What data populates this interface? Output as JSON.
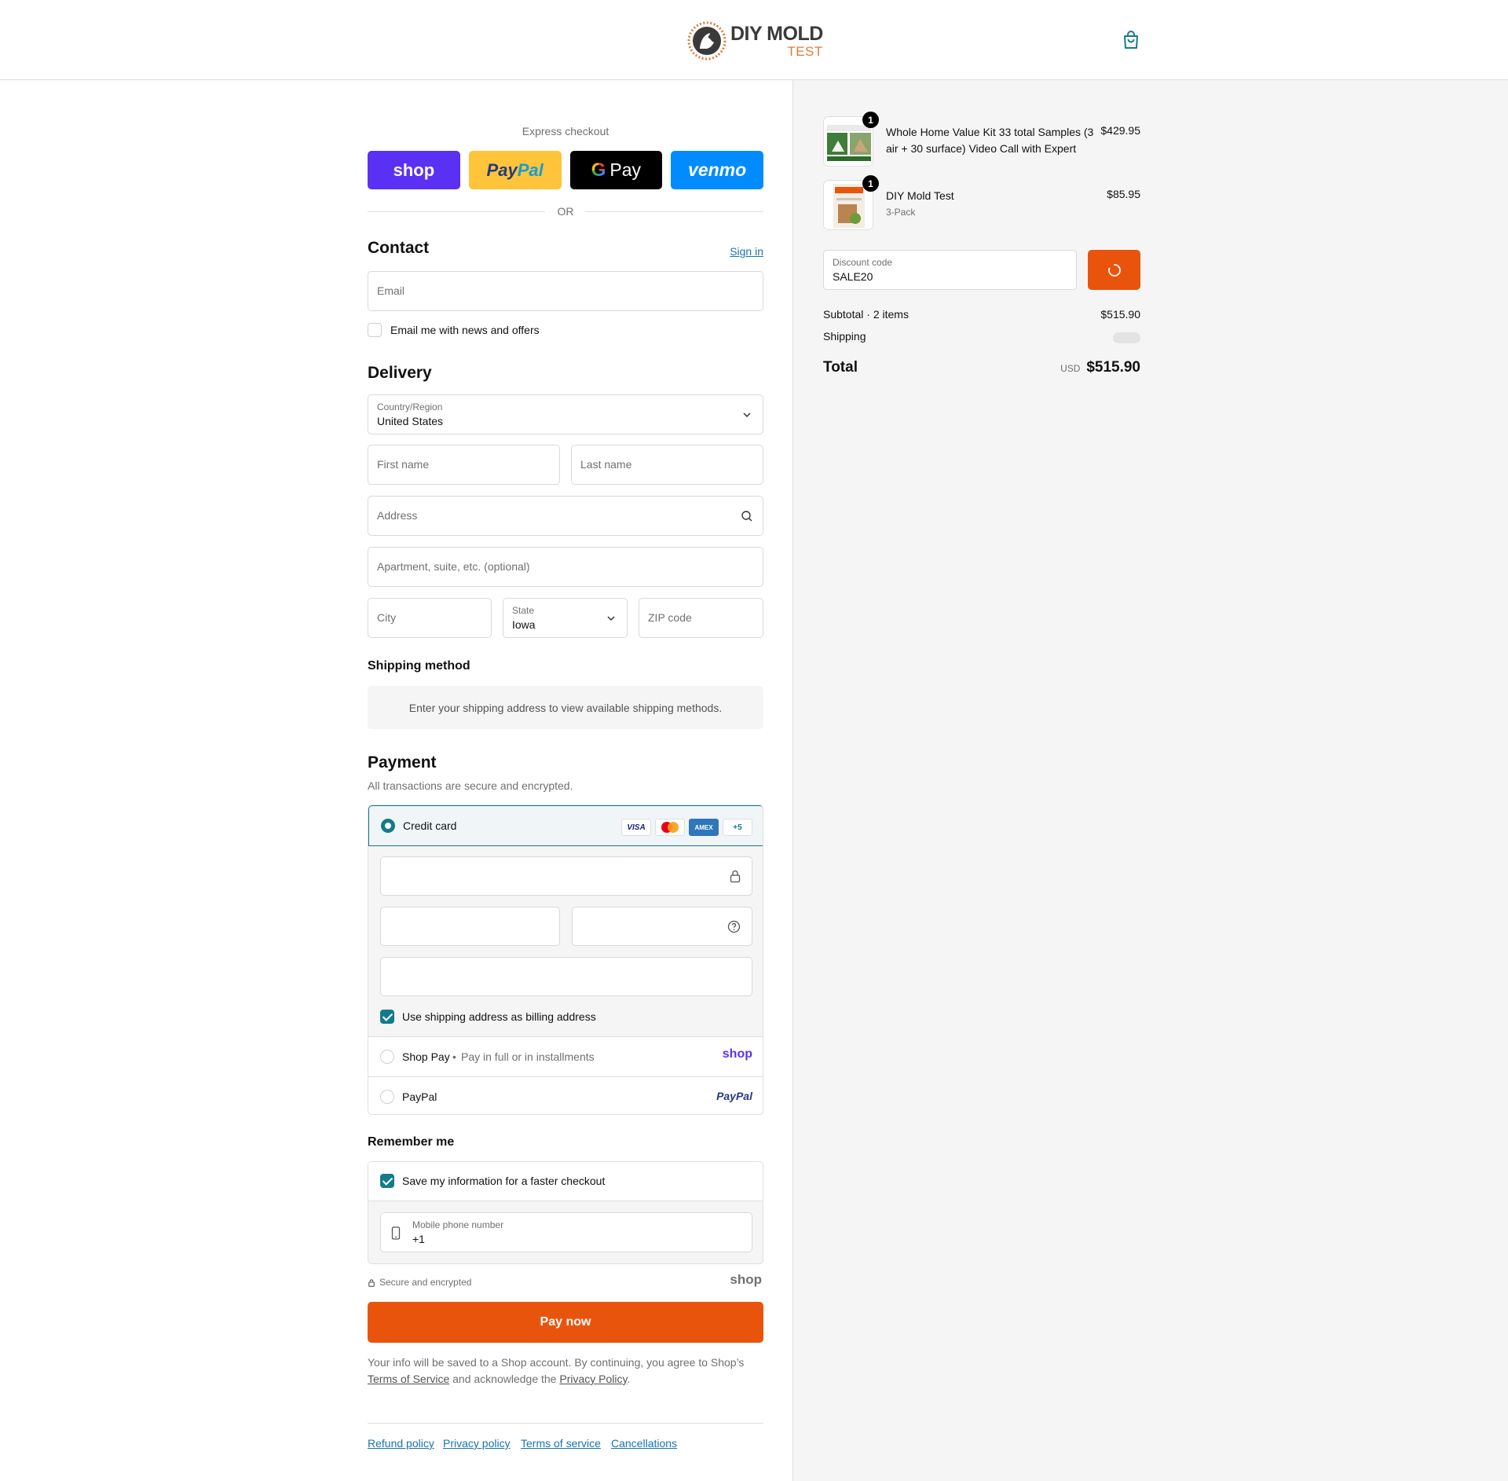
{
  "header": {
    "logo_main": "DIY MOLD",
    "logo_sub": "TEST",
    "cart_icon": "shopping-bag-icon"
  },
  "express": {
    "label": "Express checkout",
    "shop": "shop",
    "paypal": "PayPal",
    "gpay": "Pay",
    "venmo": "venmo",
    "or": "OR"
  },
  "contact": {
    "title": "Contact",
    "sign_in": "Sign in",
    "email_placeholder": "Email",
    "news_label": "Email me with news and offers",
    "news_checked": false
  },
  "delivery": {
    "title": "Delivery",
    "country_label": "Country/Region",
    "country_value": "United States",
    "first_name_placeholder": "First name",
    "last_name_placeholder": "Last name",
    "address_placeholder": "Address",
    "apartment_placeholder": "Apartment, suite, etc. (optional)",
    "city_placeholder": "City",
    "state_label": "State",
    "state_value": "Iowa",
    "zip_placeholder": "ZIP code"
  },
  "shipping_method": {
    "title": "Shipping method",
    "message": "Enter your shipping address to view available shipping methods."
  },
  "payment": {
    "title": "Payment",
    "subtitle": "All transactions are secure and encrypted.",
    "credit_card_label": "Credit card",
    "card_brands": [
      "VISA",
      "",
      "AMEX",
      "+5"
    ],
    "billing_same_label": "Use shipping address as billing address",
    "billing_same_checked": true,
    "shop_pay_label": "Shop Pay",
    "shop_pay_sub": "Pay in full or in installments",
    "shop_pay_logo": "shop",
    "paypal_label": "PayPal",
    "paypal_logo": "PayPal"
  },
  "remember": {
    "title": "Remember me",
    "save_label": "Save my information for a faster checkout",
    "save_checked": true,
    "phone_label": "Mobile phone number",
    "phone_value": "+1",
    "secure_label": "Secure and encrypted",
    "shop_logo": "shop"
  },
  "pay_now": "Pay now",
  "legal": {
    "text1": "Your info will be saved to a Shop account. By continuing, you agree to Shop’s",
    "terms": "Terms of Service",
    "text2": "and acknowledge the",
    "privacy": "Privacy Policy",
    "text3": "."
  },
  "footer": {
    "links": [
      "Refund policy",
      "Privacy policy",
      "Terms of service",
      "Cancellations"
    ]
  },
  "summary": {
    "items": [
      {
        "qty": "1",
        "name": "Whole Home Value Kit 33 total Samples (3 air + 30 surface) Video Call with Expert",
        "variant": "",
        "price": "$429.95"
      },
      {
        "qty": "1",
        "name": "DIY Mold Test",
        "variant": "3-Pack",
        "price": "$85.95"
      }
    ],
    "discount_label": "Discount code",
    "discount_value": "SALE20",
    "subtotal_label": "Subtotal · 2 items",
    "subtotal_value": "$515.90",
    "shipping_label": "Shipping",
    "total_label": "Total",
    "currency": "USD",
    "total_value": "$515.90"
  },
  "colors": {
    "accent": "#147b8a",
    "primary_button": "#e9540d",
    "link": "#1773b0"
  }
}
